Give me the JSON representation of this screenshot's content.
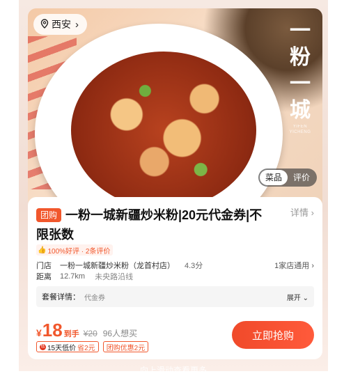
{
  "location": {
    "city": "西安"
  },
  "brand": {
    "name": "一粉一城",
    "sub": "YIFEN YICHENG"
  },
  "segment": {
    "left": "菜品",
    "right": "评价"
  },
  "deal": {
    "tag": "团购",
    "title": "一粉一城新疆炒米粉|20元代金券|不限张数",
    "detail_label": "详情"
  },
  "praise": {
    "text": "100%好评 · 2条评价"
  },
  "store": {
    "label": "门店",
    "name": "一粉一城新疆炒米粉（龙首村店）",
    "rating": "4.3分",
    "applicable": "1家店通用"
  },
  "distance": {
    "label": "距离",
    "value": "12.7km",
    "note": "未央路沿线"
  },
  "package": {
    "label": "套餐详情：",
    "value": "代金券",
    "expand": "展开"
  },
  "price": {
    "currency": "¥",
    "current": "18",
    "suffix": "到手",
    "original": "¥20",
    "want": "96人想买"
  },
  "badges": [
    {
      "prefix": "15天低价",
      "highlight": "省2元"
    },
    {
      "text": "团购优惠2元"
    }
  ],
  "buy_button": {
    "label": "立即抢购"
  },
  "bottom_hint": {
    "text": "向上滑动查看更多"
  },
  "colors": {
    "accent": "#f1572c",
    "button": "#f04a2a"
  }
}
